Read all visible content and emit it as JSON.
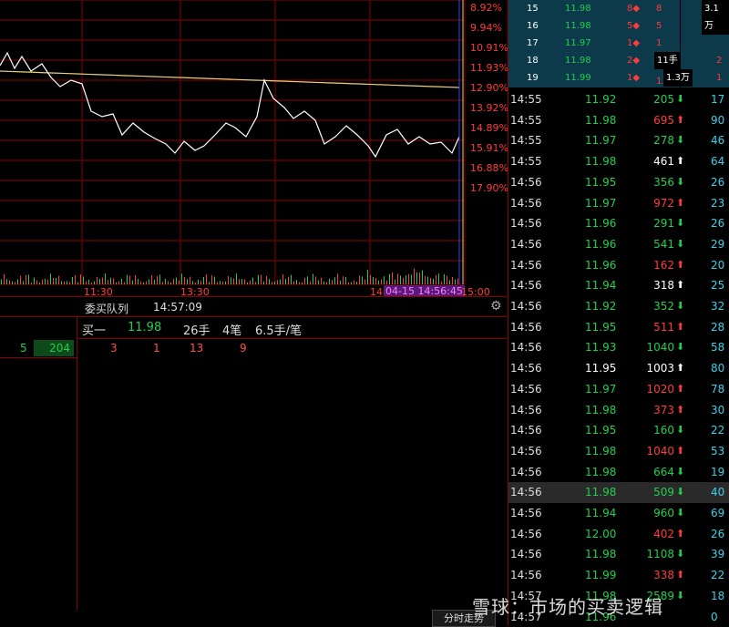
{
  "chart": {
    "pct_labels": [
      "8.92%",
      "9.94%",
      "10.91%",
      "11.93%",
      "12.90%",
      "13.92%",
      "14.89%",
      "15.91%",
      "16.88%",
      "17.90%"
    ],
    "time_labels": [
      "11:30",
      "13:30",
      "14",
      "15:00"
    ],
    "cursor_label": "04-15 14:56:45"
  },
  "queue": {
    "title": "委买队列",
    "time": "14:57:09",
    "buy_label": "买一",
    "buy_price": "11.98",
    "buy_hands": "26手",
    "buy_count": "4笔",
    "buy_avg": "6.5手/笔",
    "orders": [
      "3",
      "1",
      "13",
      "9"
    ],
    "left_a": "5",
    "left_b": "204"
  },
  "depth": [
    {
      "lvl": "15",
      "price": "11.98",
      "a": "8",
      "b": "8",
      "c": "3.1万"
    },
    {
      "lvl": "16",
      "price": "11.98",
      "a": "5",
      "b": "5",
      "c": ""
    },
    {
      "lvl": "17",
      "price": "11.97",
      "a": "1",
      "b": "1",
      "c": ""
    },
    {
      "lvl": "18",
      "price": "11.98",
      "a": "2",
      "b": "11手",
      "c": "2"
    },
    {
      "lvl": "19",
      "price": "11.99",
      "a": "1",
      "b": "1.3万",
      "c": "1"
    }
  ],
  "trades": [
    {
      "t": "14:55",
      "p": "11.92",
      "pc": "green",
      "v": "205",
      "vc": "green",
      "d": "down",
      "x": "17"
    },
    {
      "t": "14:55",
      "p": "11.98",
      "pc": "green",
      "v": "695",
      "vc": "red",
      "d": "up",
      "x": "90"
    },
    {
      "t": "14:55",
      "p": "11.97",
      "pc": "green",
      "v": "278",
      "vc": "green",
      "d": "down",
      "x": "46"
    },
    {
      "t": "14:55",
      "p": "11.98",
      "pc": "green",
      "v": "461",
      "vc": "white",
      "d": "up",
      "x": "64"
    },
    {
      "t": "14:56",
      "p": "11.95",
      "pc": "green",
      "v": "356",
      "vc": "green",
      "d": "down",
      "x": "26"
    },
    {
      "t": "14:56",
      "p": "11.97",
      "pc": "green",
      "v": "972",
      "vc": "red",
      "d": "up",
      "x": "23"
    },
    {
      "t": "14:56",
      "p": "11.96",
      "pc": "green",
      "v": "291",
      "vc": "green",
      "d": "down",
      "x": "26"
    },
    {
      "t": "14:56",
      "p": "11.96",
      "pc": "green",
      "v": "541",
      "vc": "green",
      "d": "down",
      "x": "29"
    },
    {
      "t": "14:56",
      "p": "11.96",
      "pc": "green",
      "v": "162",
      "vc": "red",
      "d": "up",
      "x": "20"
    },
    {
      "t": "14:56",
      "p": "11.94",
      "pc": "green",
      "v": "318",
      "vc": "white",
      "d": "up",
      "x": "25"
    },
    {
      "t": "14:56",
      "p": "11.92",
      "pc": "green",
      "v": "352",
      "vc": "green",
      "d": "down",
      "x": "32"
    },
    {
      "t": "14:56",
      "p": "11.95",
      "pc": "green",
      "v": "511",
      "vc": "red",
      "d": "up",
      "x": "28"
    },
    {
      "t": "14:56",
      "p": "11.93",
      "pc": "green",
      "v": "1040",
      "vc": "green",
      "d": "down",
      "x": "58"
    },
    {
      "t": "14:56",
      "p": "11.95",
      "pc": "white",
      "v": "1003",
      "vc": "white",
      "d": "up",
      "x": "80"
    },
    {
      "t": "14:56",
      "p": "11.97",
      "pc": "green",
      "v": "1020",
      "vc": "red",
      "d": "up",
      "x": "78"
    },
    {
      "t": "14:56",
      "p": "11.98",
      "pc": "green",
      "v": "373",
      "vc": "red",
      "d": "up",
      "x": "30"
    },
    {
      "t": "14:56",
      "p": "11.95",
      "pc": "green",
      "v": "160",
      "vc": "green",
      "d": "down",
      "x": "22"
    },
    {
      "t": "14:56",
      "p": "11.98",
      "pc": "green",
      "v": "1040",
      "vc": "red",
      "d": "up",
      "x": "53"
    },
    {
      "t": "14:56",
      "p": "11.98",
      "pc": "green",
      "v": "664",
      "vc": "green",
      "d": "down",
      "x": "19"
    },
    {
      "t": "14:56",
      "p": "11.98",
      "pc": "green",
      "v": "509",
      "vc": "green",
      "d": "down",
      "x": "40"
    },
    {
      "t": "14:56",
      "p": "11.94",
      "pc": "green",
      "v": "960",
      "vc": "green",
      "d": "down",
      "x": "69"
    },
    {
      "t": "14:56",
      "p": "12.00",
      "pc": "green",
      "v": "402",
      "vc": "red",
      "d": "up",
      "x": "26"
    },
    {
      "t": "14:56",
      "p": "11.98",
      "pc": "green",
      "v": "1108",
      "vc": "green",
      "d": "down",
      "x": "39"
    },
    {
      "t": "14:56",
      "p": "11.99",
      "pc": "green",
      "v": "338",
      "vc": "red",
      "d": "up",
      "x": "22"
    },
    {
      "t": "14:57",
      "p": "11.98",
      "pc": "green",
      "v": "2589",
      "vc": "green",
      "d": "down",
      "x": "18"
    },
    {
      "t": "14:57",
      "p": "11.96",
      "pc": "green",
      "v": "",
      "vc": "green",
      "d": "",
      "x": "0"
    }
  ],
  "footer": {
    "tab": "分时走势"
  },
  "watermark": "雪球：市场的买卖逻辑",
  "colors": {
    "up": "#ff3b3b",
    "down": "#1fd04c",
    "grid": "#8b0000",
    "cyan": "#3ad1e8"
  }
}
